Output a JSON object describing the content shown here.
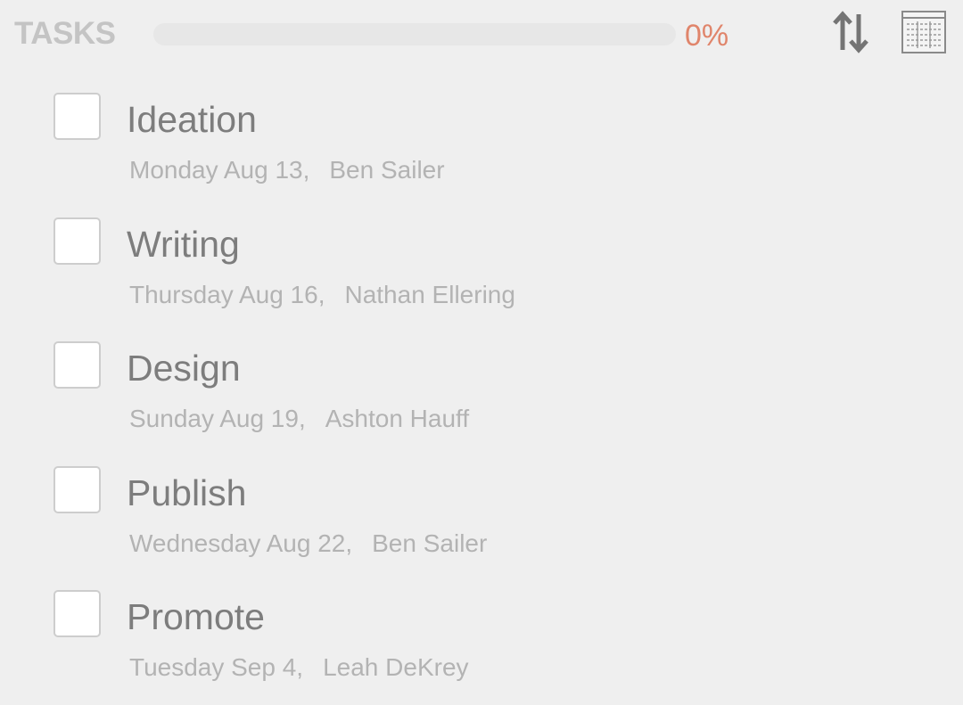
{
  "header": {
    "title": "TASKS",
    "progress_percent_label": "0%",
    "progress_value": 0,
    "accent_color": "#e0856b",
    "sort_icon": "sort-arrows-icon",
    "layout_icon": "calendar-grid-icon"
  },
  "tasks": [
    {
      "name": "Ideation",
      "date": "Monday Aug 13,",
      "assignee": "Ben Sailer",
      "checked": false
    },
    {
      "name": "Writing",
      "date": "Thursday Aug 16,",
      "assignee": "Nathan Ellering",
      "checked": false
    },
    {
      "name": "Design",
      "date": "Sunday Aug 19,",
      "assignee": "Ashton Hauff",
      "checked": false
    },
    {
      "name": "Publish",
      "date": "Wednesday Aug 22,",
      "assignee": "Ben Sailer",
      "checked": false
    },
    {
      "name": "Promote",
      "date": "Tuesday Sep 4,",
      "assignee": "Leah DeKrey",
      "checked": false
    }
  ]
}
